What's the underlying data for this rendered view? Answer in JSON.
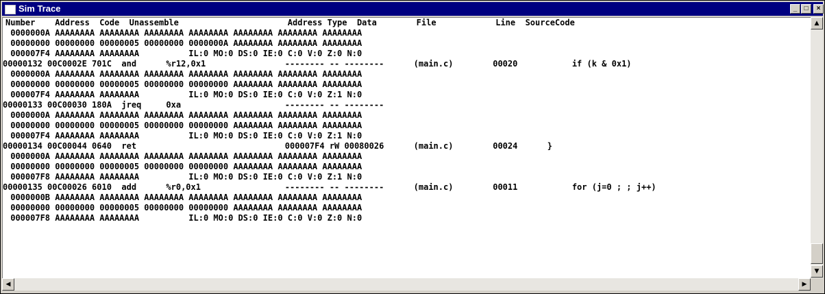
{
  "window": {
    "title": "Sim Trace"
  },
  "titlebar_buttons": {
    "minimize": "_",
    "maximize": "□",
    "close": "×"
  },
  "scroll_glyphs": {
    "up": "▲",
    "down": "▼",
    "left": "◀",
    "right": "▶"
  },
  "header": "Number    Address  Code  Unassemble                      Address Type  Data        File            Line  SourceCode",
  "lines": [
    " 0000000A AAAAAAAA AAAAAAAA AAAAAAAA AAAAAAAA AAAAAAAA AAAAAAAA AAAAAAAA",
    " 00000000 00000000 00000005 00000000 0000000A AAAAAAAA AAAAAAAA AAAAAAAA",
    " 000007F4 AAAAAAAA AAAAAAAA          IL:0 MO:0 DS:0 IE:0 C:0 V:0 Z:0 N:0",
    "00000132 00C0002E 701C  and      %r12,0x1                -------- -- --------      (main.c)        00020           if (k & 0x1)",
    " 0000000A AAAAAAAA AAAAAAAA AAAAAAAA AAAAAAAA AAAAAAAA AAAAAAAA AAAAAAAA",
    " 00000000 00000000 00000005 00000000 00000000 AAAAAAAA AAAAAAAA AAAAAAAA",
    " 000007F4 AAAAAAAA AAAAAAAA          IL:0 MO:0 DS:0 IE:0 C:0 V:0 Z:1 N:0",
    "00000133 00C00030 180A  jreq     0xa                     -------- -- --------",
    " 0000000A AAAAAAAA AAAAAAAA AAAAAAAA AAAAAAAA AAAAAAAA AAAAAAAA AAAAAAAA",
    " 00000000 00000000 00000005 00000000 00000000 AAAAAAAA AAAAAAAA AAAAAAAA",
    " 000007F4 AAAAAAAA AAAAAAAA          IL:0 MO:0 DS:0 IE:0 C:0 V:0 Z:1 N:0",
    "00000134 00C00044 0640  ret                              000007F4 rW 00080026      (main.c)        00024      }",
    " 0000000A AAAAAAAA AAAAAAAA AAAAAAAA AAAAAAAA AAAAAAAA AAAAAAAA AAAAAAAA",
    " 00000000 00000000 00000005 00000000 00000000 AAAAAAAA AAAAAAAA AAAAAAAA",
    " 000007F8 AAAAAAAA AAAAAAAA          IL:0 MO:0 DS:0 IE:0 C:0 V:0 Z:1 N:0",
    "00000135 00C00026 6010  add      %r0,0x1                 -------- -- --------      (main.c)        00011           for (j=0 ; ; j++)",
    " 0000000B AAAAAAAA AAAAAAAA AAAAAAAA AAAAAAAA AAAAAAAA AAAAAAAA AAAAAAAA",
    " 00000000 00000000 00000005 00000000 00000000 AAAAAAAA AAAAAAAA AAAAAAAA",
    " 000007F8 AAAAAAAA AAAAAAAA          IL:0 MO:0 DS:0 IE:0 C:0 V:0 Z:0 N:0"
  ]
}
